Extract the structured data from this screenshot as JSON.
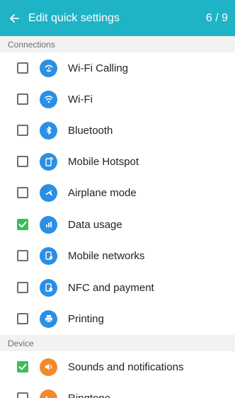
{
  "app_bar": {
    "title": "Edit quick settings",
    "page_indicator": "6 / 9"
  },
  "sections": {
    "connections": {
      "header": "Connections"
    },
    "device": {
      "header": "Device"
    }
  },
  "items": [
    {
      "label": "Wi-Fi Calling",
      "checked": false,
      "icon": "wifi-calling-icon",
      "color": "#2b8fe3"
    },
    {
      "label": "Wi-Fi",
      "checked": false,
      "icon": "wifi-icon",
      "color": "#2b8fe3"
    },
    {
      "label": "Bluetooth",
      "checked": false,
      "icon": "bluetooth-icon",
      "color": "#2b8fe3"
    },
    {
      "label": "Mobile Hotspot",
      "checked": false,
      "icon": "hotspot-icon",
      "color": "#2b8fe3"
    },
    {
      "label": "Airplane mode",
      "checked": false,
      "icon": "airplane-icon",
      "color": "#2b8fe3"
    },
    {
      "label": "Data usage",
      "checked": true,
      "icon": "data-usage-icon",
      "color": "#2b8fe3"
    },
    {
      "label": "Mobile networks",
      "checked": false,
      "icon": "mobile-networks-icon",
      "color": "#2b8fe3"
    },
    {
      "label": "NFC and payment",
      "checked": false,
      "icon": "nfc-icon",
      "color": "#2b8fe3"
    },
    {
      "label": "Printing",
      "checked": false,
      "icon": "printer-icon",
      "color": "#2b8fe3"
    },
    {
      "label": "Sounds and notifications",
      "checked": true,
      "icon": "speaker-icon",
      "color": "#f08a2c"
    },
    {
      "label": "Ringtone",
      "checked": false,
      "icon": "ringtone-icon",
      "color": "#f08a2c"
    }
  ],
  "colors": {
    "app_bar": "#1fb3c6",
    "checkbox_checked": "#3cbd5b",
    "connection_icon": "#2b8fe3",
    "device_icon": "#f08a2c"
  }
}
